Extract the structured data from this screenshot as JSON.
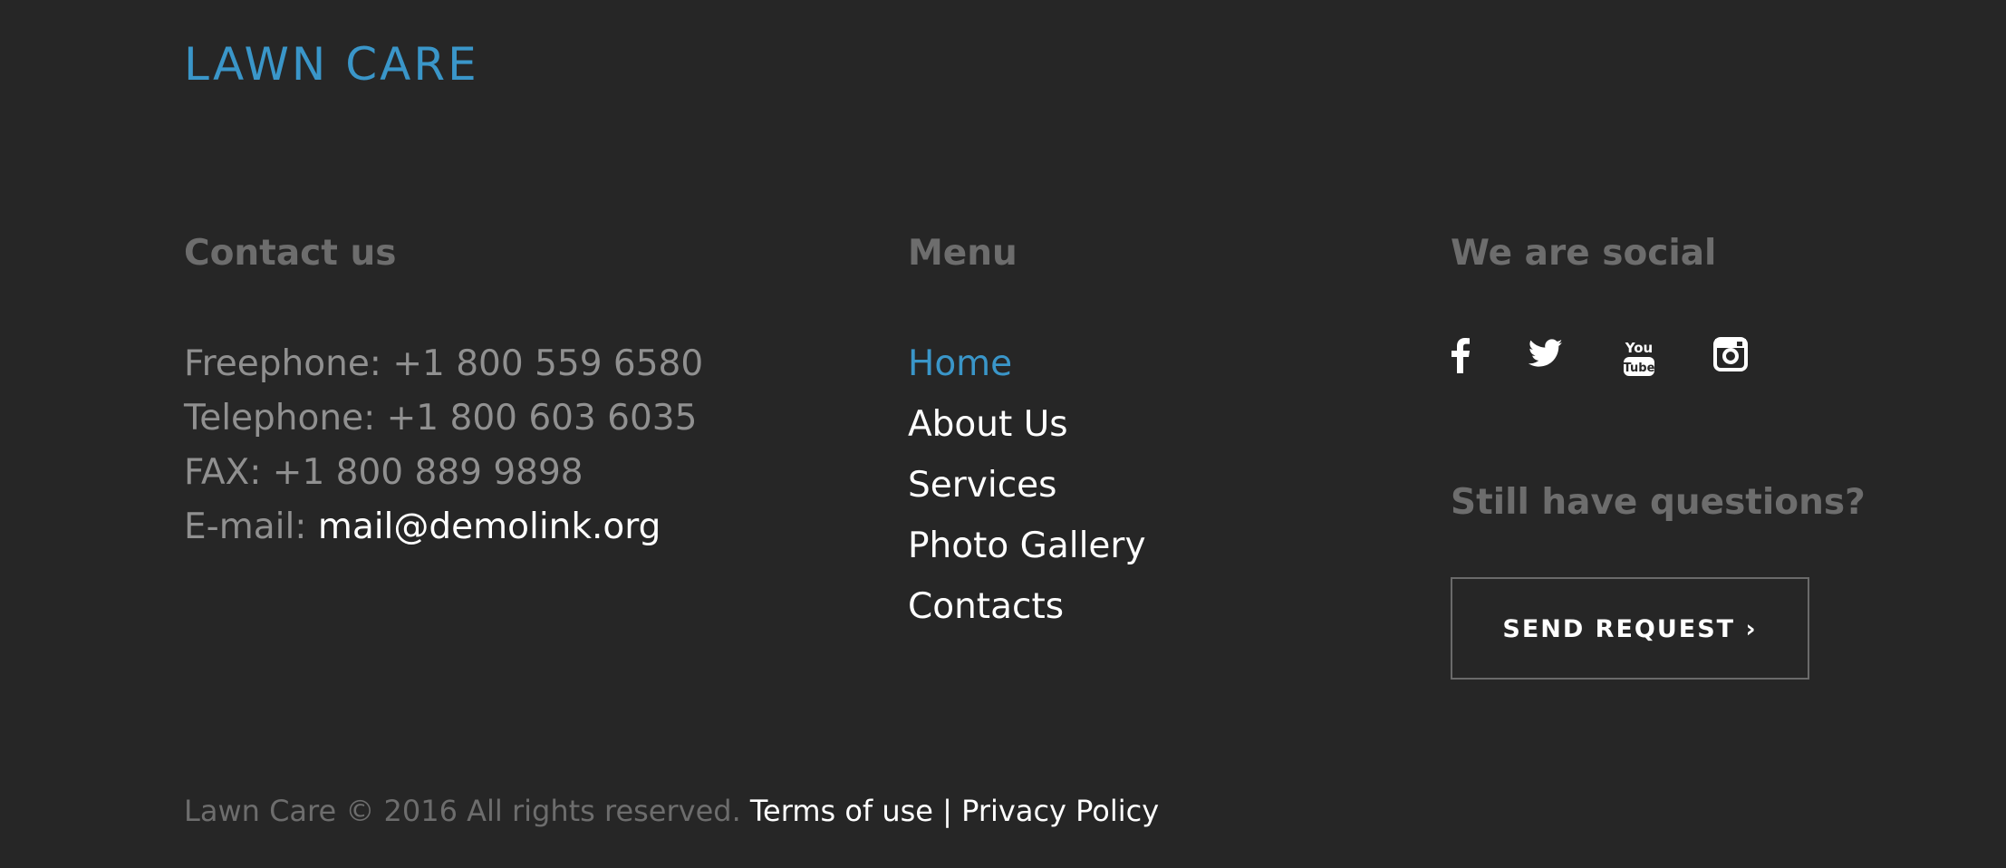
{
  "brand": {
    "logo_text": "LAWN CARE",
    "accent_color": "#3a96c9"
  },
  "contact": {
    "title": "Contact us",
    "freephone_label": "Freephone:",
    "freephone_value": "+1 800 559 6580",
    "telephone_label": "Telephone:",
    "telephone_value": "+1 800 603 6035",
    "fax_label": "FAX:",
    "fax_value": "+1 800 889 9898",
    "email_label": "E-mail:",
    "email_value": "mail@demolink.org"
  },
  "menu": {
    "title": "Menu",
    "items": [
      {
        "label": "Home",
        "active": true
      },
      {
        "label": "About Us",
        "active": false
      },
      {
        "label": "Services",
        "active": false
      },
      {
        "label": "Photo Gallery",
        "active": false
      },
      {
        "label": "Contacts",
        "active": false
      }
    ]
  },
  "social": {
    "title": "We are social",
    "icons": [
      "facebook-icon",
      "twitter-icon",
      "youtube-icon",
      "instagram-icon"
    ],
    "questions_title": "Still have questions?",
    "send_button_label": "SEND REQUEST ›"
  },
  "footer": {
    "copyright": "Lawn Care © 2016 All rights reserved.",
    "terms_label": "Terms of use",
    "separator": "|",
    "privacy_label": "Privacy Policy"
  }
}
